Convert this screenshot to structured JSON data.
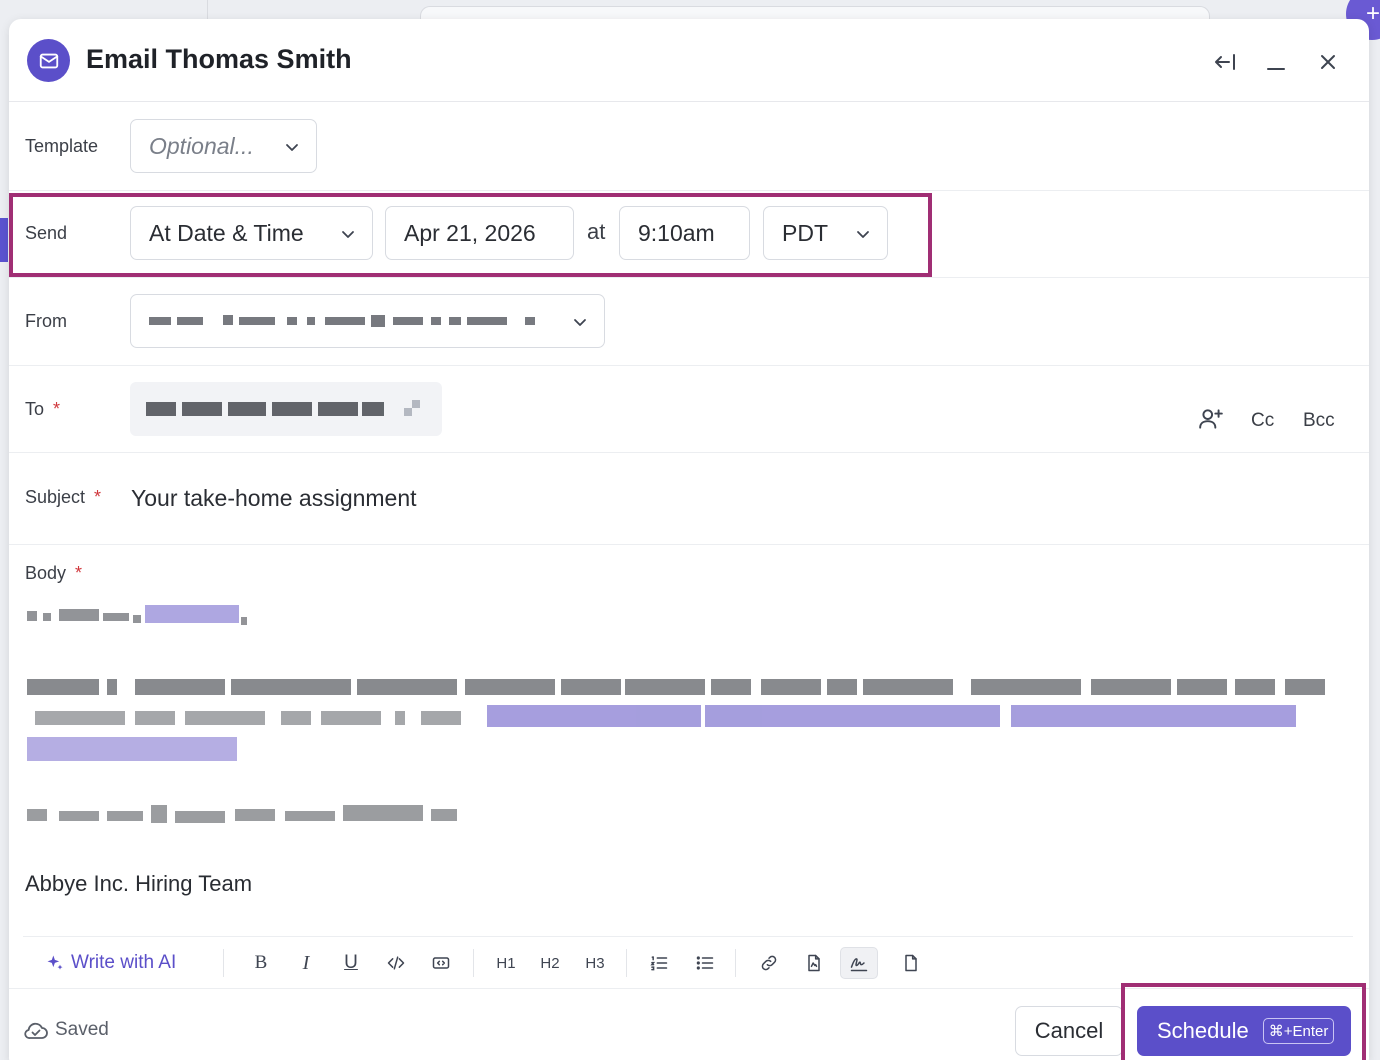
{
  "modal": {
    "title": "Email Thomas Smith"
  },
  "fields": {
    "template": {
      "label": "Template",
      "placeholder": "Optional..."
    },
    "send": {
      "label": "Send",
      "mode": "At Date & Time",
      "date": "Apr 21, 2026",
      "at_label": "at",
      "time": "9:10am",
      "timezone": "PDT"
    },
    "from": {
      "label": "From"
    },
    "to": {
      "label": "To",
      "required_mark": "*",
      "cc_label": "Cc",
      "bcc_label": "Bcc"
    },
    "subject": {
      "label": "Subject",
      "required_mark": "*",
      "value": "Your take-home assignment"
    },
    "body": {
      "label": "Body",
      "required_mark": "*",
      "signoff": "Abbye Inc. Hiring Team"
    }
  },
  "toolbar": {
    "write_ai": "Write with AI",
    "bold": "B",
    "italic": "I",
    "underline": "U",
    "h1": "H1",
    "h2": "H2",
    "h3": "H3"
  },
  "footer": {
    "status": "Saved",
    "cancel_label": "Cancel",
    "schedule_label": "Schedule",
    "schedule_shortcut": "⌘+Enter"
  },
  "colors": {
    "accent": "#5b4fc9",
    "highlight": "#a02e74",
    "required": "#d0373c"
  }
}
